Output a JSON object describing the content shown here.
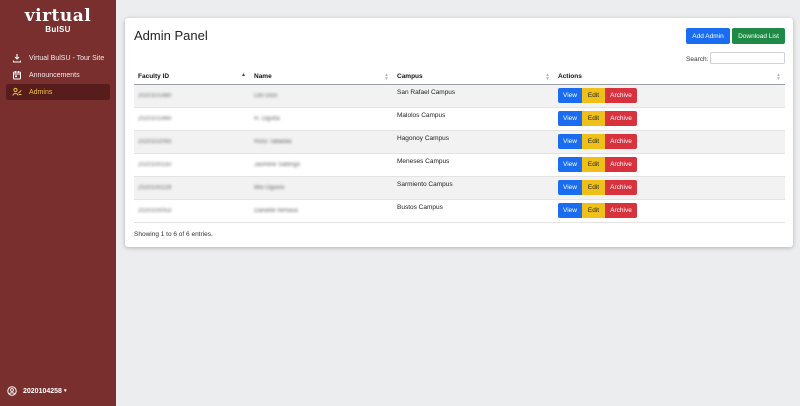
{
  "sidebar": {
    "logo": {
      "main": "virtual",
      "sub": "BulSU"
    },
    "items": [
      {
        "label": "Virtual BulSU - Tour Site",
        "icon": "tour-icon"
      },
      {
        "label": "Announcements",
        "icon": "calendar-icon"
      },
      {
        "label": "Admins",
        "icon": "admins-icon",
        "active": true
      }
    ],
    "user": {
      "id": "2020104258",
      "caret": "▾"
    }
  },
  "panel": {
    "title": "Admin Panel",
    "add_admin": "Add Admin",
    "download_list": "Download List",
    "search_label": "Search:",
    "search_value": "",
    "columns": [
      "Faculty ID",
      "Name",
      "Campus",
      "Actions"
    ],
    "rows": [
      {
        "faculty_id": "2020101480",
        "name": "Lito Dizo",
        "campus": "San Rafael Campus"
      },
      {
        "faculty_id": "2020101460",
        "name": "H. Ogutta",
        "campus": "Malolos Campus"
      },
      {
        "faculty_id": "2020102093",
        "name": "Ross Tabadas",
        "campus": "Hagonoy Campus"
      },
      {
        "faculty_id": "2020100150",
        "name": "Jasmine Sabingo",
        "campus": "Meneses Campus"
      },
      {
        "faculty_id": "2020100229",
        "name": "Mio Oguvio",
        "campus": "Sarmiento Campus"
      },
      {
        "faculty_id": "2020100053",
        "name": "Danielle Nimasa",
        "campus": "Bustos Campus"
      }
    ],
    "actions": {
      "view": "View",
      "edit": "Edit",
      "archive": "Archive"
    },
    "info": "Showing 1 to 6 of 6 entries."
  },
  "colors": {
    "sidebar": "#7a2f2f",
    "active_bg": "#571d1d",
    "active_text": "#f0c342",
    "primary": "#1a6df0",
    "success": "#1e8a46",
    "warning": "#f0c01a",
    "danger": "#d9323f"
  }
}
